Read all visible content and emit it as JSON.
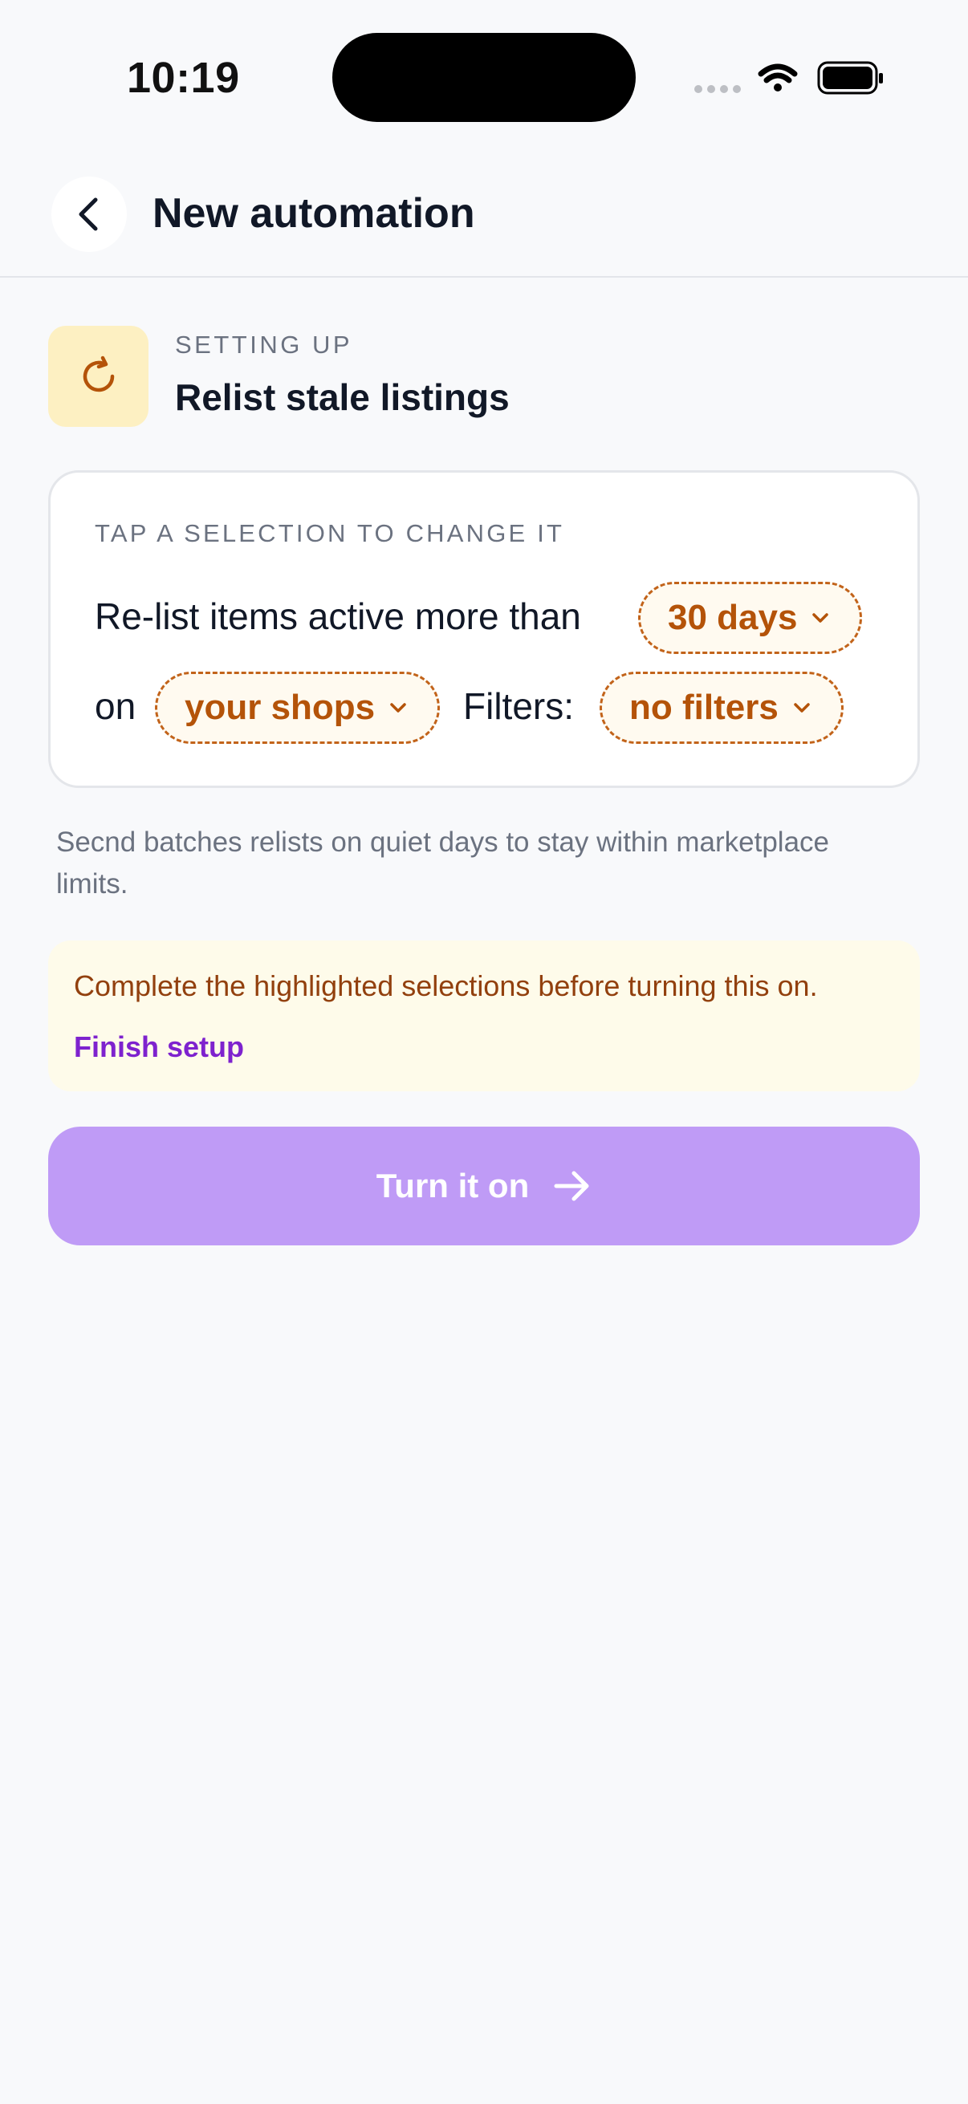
{
  "status_bar": {
    "time": "10:19"
  },
  "header": {
    "title": "New automation",
    "back_icon": "chevron-left-icon"
  },
  "setup": {
    "eyebrow": "SETTING UP",
    "title": "Relist stale listings",
    "icon": "refresh-icon"
  },
  "selection_card": {
    "eyebrow": "TAP A SELECTION TO CHANGE IT",
    "text_1": "Re-list items active more than",
    "chip_days": "30 days",
    "text_2": "on",
    "chip_shops": "your shops",
    "text_3": "Filters:",
    "chip_filters": "no filters"
  },
  "note": "Secnd batches relists on quiet days to stay within marketplace limits.",
  "warning": {
    "message": "Complete the highlighted selections before turning this on.",
    "link": "Finish setup"
  },
  "primary_button": {
    "label": "Turn it on",
    "icon": "arrow-right-icon"
  },
  "colors": {
    "accent_purple": "#bf9bf6",
    "link_purple": "#7e22ce",
    "chip_orange": "#b45309",
    "warning_bg": "#fefbea",
    "icon_bg": "#fdf0c2"
  }
}
